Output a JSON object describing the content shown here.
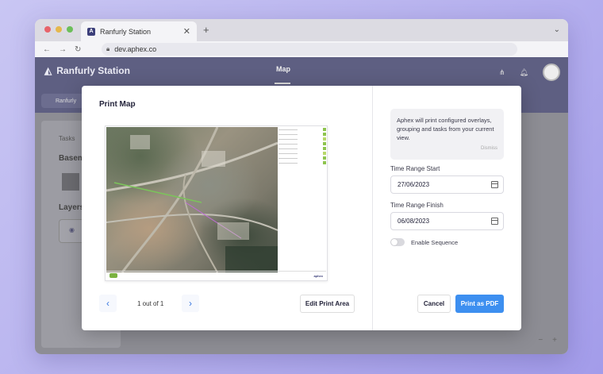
{
  "browser": {
    "tab_title": "Ranfurly Station",
    "tab_close": "✕",
    "new_tab": "+",
    "url": "dev.aphex.co"
  },
  "app": {
    "brand": "Ranfurly Station",
    "nav_map": "Map",
    "project_chip": "Ranfurly",
    "left_panel": {
      "tasks": "Tasks",
      "basemap": "Basem",
      "layers": "Layers"
    },
    "zoom_minus": "−",
    "zoom_plus": "+"
  },
  "modal": {
    "title": "Print Map",
    "pager": {
      "text": "1 out of 1",
      "prev": "‹",
      "next": "›"
    },
    "edit_print_area": "Edit Print Area",
    "info_text": "Aphex will print configured overlays, grouping and tasks from your current view.",
    "info_dismiss": "Dismiss",
    "range_start_label": "Time Range Start",
    "range_start_value": "27/06/2023",
    "range_finish_label": "Time Range Finish",
    "range_finish_value": "06/08/2023",
    "sequence_label": "Enable Sequence",
    "sequence_enabled": false,
    "cancel": "Cancel",
    "print_pdf": "Print as PDF",
    "preview_brand": "aphex"
  },
  "colors": {
    "accent": "#3d8ff0",
    "header": "#5e5f82"
  }
}
